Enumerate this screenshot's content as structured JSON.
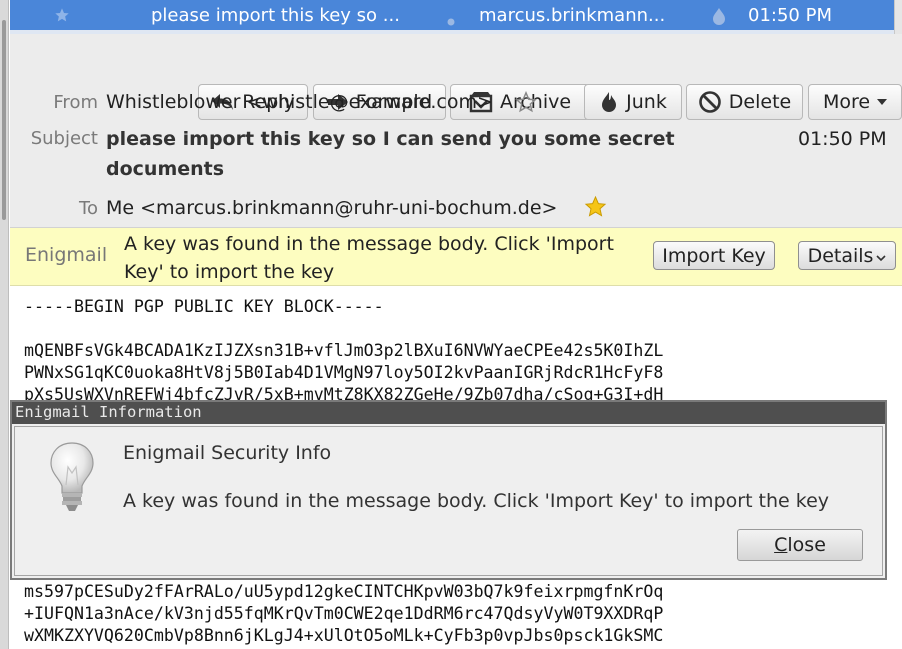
{
  "message_row": {
    "subject": "please import this key so ...",
    "sender": "marcus.brinkmann...",
    "time": "01:50 PM"
  },
  "toolbar": {
    "reply_label": "Reply",
    "forward_label": "Forward",
    "archive_label": "Archive",
    "junk_label": "Junk",
    "delete_label": "Delete",
    "more_label": "More"
  },
  "header": {
    "from_label": "From",
    "from_value": "Whistleblower <whistle@example.com>",
    "subject_label": "Subject",
    "subject_value": "please import this key so I can send you some secret documents",
    "date_value": "01:50 PM",
    "to_label": "To",
    "to_value": "Me <marcus.brinkmann@ruhr-uni-bochum.de>"
  },
  "enigmail_bar": {
    "label": "Enigmail",
    "message": "A key was found in the message body. Click 'Import Key' to import the key",
    "import_button": "Import Key",
    "details_button": "Details"
  },
  "body": {
    "begin_line": "-----BEGIN PGP PUBLIC KEY BLOCK-----",
    "key_lines_top": [
      "mQENBFsVGk4BCADA1KzIJZXsn31B+vflJmO3p2lBXuI6NVWYaeCPEe42s5K0IhZL",
      "PWNxSG1qKC0uoka8HtV8j5B0Iab4D1VMgN97loy5OI2kvPaanIGRjRdcR1HcFyF8",
      "pXs5UsWXVnREFWj4bfcZJvR/5xB+mvMtZ8KX82ZGeHe/9Zb07dha/cSoq+G3I+dH"
    ],
    "key_lines_bottom": [
      "ms597pCESuDy2fFArRALo/uU5ypd12gkeCINTCHKpvW03bQ7k9feixrpmgfnKrOq",
      "+IUFQN1a3nAce/kV3njd55fqMKrQvTm0CWE2qe1DdRM6rc47QdsyVyW0T9XXDRqP",
      "wXMKZXYVQ620CmbVp8Bnn6jKLgJ4+xUlOtO5oMLk+CyFb3p0vpJbs0psck1GkSMC"
    ]
  },
  "dialog": {
    "title": "Enigmail Information",
    "heading": "Enigmail Security Info",
    "text": "A key was found in the message body. Click 'Import Key' to import the key",
    "close_first": "C",
    "close_rest": "lose"
  },
  "colors": {
    "selection": "#4a86d9",
    "notification_bar": "#fdfdc0",
    "dialog_title": "#4f4f4f"
  }
}
